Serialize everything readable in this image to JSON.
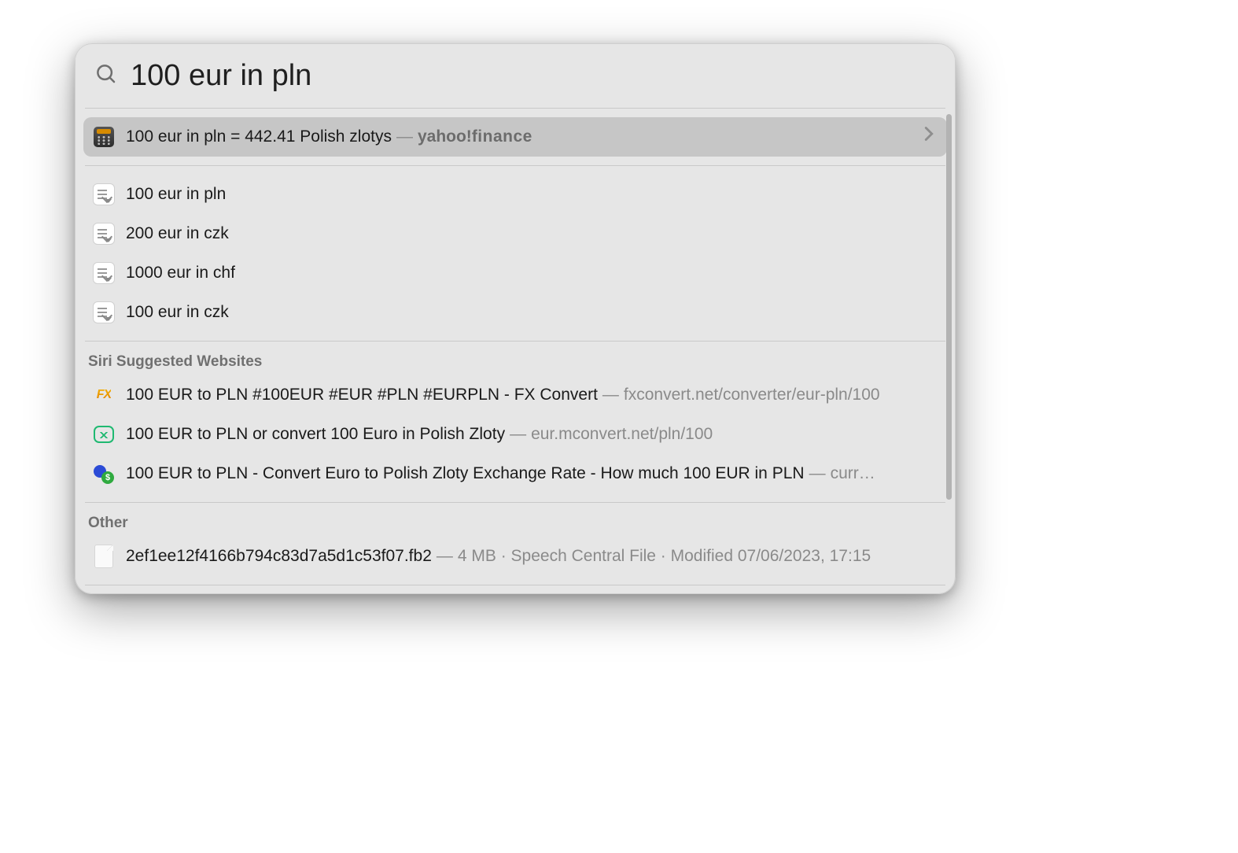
{
  "search": {
    "query": "100 eur in pln"
  },
  "top_result": {
    "text": "100 eur in pln = 442.41 Polish zlotys",
    "source_prefix": "yahoo!",
    "source_suffix": "finance"
  },
  "history": [
    "100 eur in pln",
    "200 eur in czk",
    "1000 eur in chf",
    "100 eur in czk"
  ],
  "sections": {
    "siri": {
      "header": "Siri Suggested Websites",
      "items": [
        {
          "title": "100 EUR to PLN #100EUR #EUR #PLN #EURPLN - FX Convert",
          "url": "fxconvert.net/converter/eur-pln/100",
          "icon": "fx"
        },
        {
          "title": "100 EUR to PLN or convert 100 Euro in Polish Zloty",
          "url": "eur.mconvert.net/pln/100",
          "icon": "mconv"
        },
        {
          "title": "100 EUR to PLN - Convert Euro to Polish Zloty Exchange Rate - How much 100 EUR in PLN",
          "url": "curr…",
          "icon": "curr"
        }
      ]
    },
    "other": {
      "header": "Other",
      "items": [
        {
          "title": "2ef1ee12f4166b794c83d7a5d1c53f07.fb2",
          "meta": "4 MB · Speech Central File · Modified 07/06/2023, 17:15"
        }
      ]
    }
  }
}
